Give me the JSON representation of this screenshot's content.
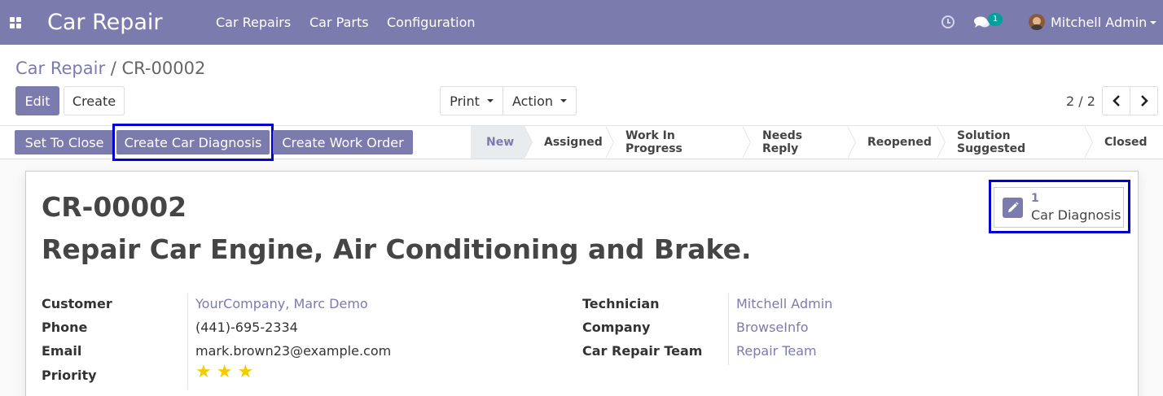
{
  "navbar": {
    "app_title": "Car Repair",
    "menu": [
      "Car Repairs",
      "Car Parts",
      "Configuration"
    ],
    "chat_badge": "1",
    "user_name": "Mitchell Admin"
  },
  "breadcrumb": {
    "parent": "Car Repair",
    "separator": " / ",
    "current": "CR-00002"
  },
  "buttons": {
    "edit": "Edit",
    "create": "Create",
    "print": "Print",
    "action": "Action"
  },
  "pager": {
    "text": "2 / 2"
  },
  "statusbar": {
    "actions": [
      "Set To Close",
      "Create Car Diagnosis",
      "Create Work Order"
    ],
    "stages": [
      "New",
      "Assigned",
      "Work In Progress",
      "Needs Reply",
      "Reopened",
      "Solution Suggested",
      "Closed"
    ],
    "active_stage": "New"
  },
  "record": {
    "code": "CR-00002",
    "title": "Repair Car Engine, Air Conditioning and Brake.",
    "smart_button": {
      "value": "1",
      "label": "Car Diagnosis"
    },
    "left_fields": {
      "customer": {
        "label": "Customer",
        "value": "YourCompany, Marc Demo"
      },
      "phone": {
        "label": "Phone",
        "value": "(441)-695-2334"
      },
      "email": {
        "label": "Email",
        "value": "mark.brown23@example.com"
      },
      "priority": {
        "label": "Priority",
        "stars": 3
      }
    },
    "right_fields": {
      "technician": {
        "label": "Technician",
        "value": "Mitchell Admin"
      },
      "company": {
        "label": "Company",
        "value": "BrowseInfo"
      },
      "team": {
        "label": "Car Repair Team",
        "value": "Repair Team"
      }
    }
  },
  "colors": {
    "brand": "#7c7bad",
    "highlight": "#0000d6",
    "star": "#f3cc00"
  }
}
